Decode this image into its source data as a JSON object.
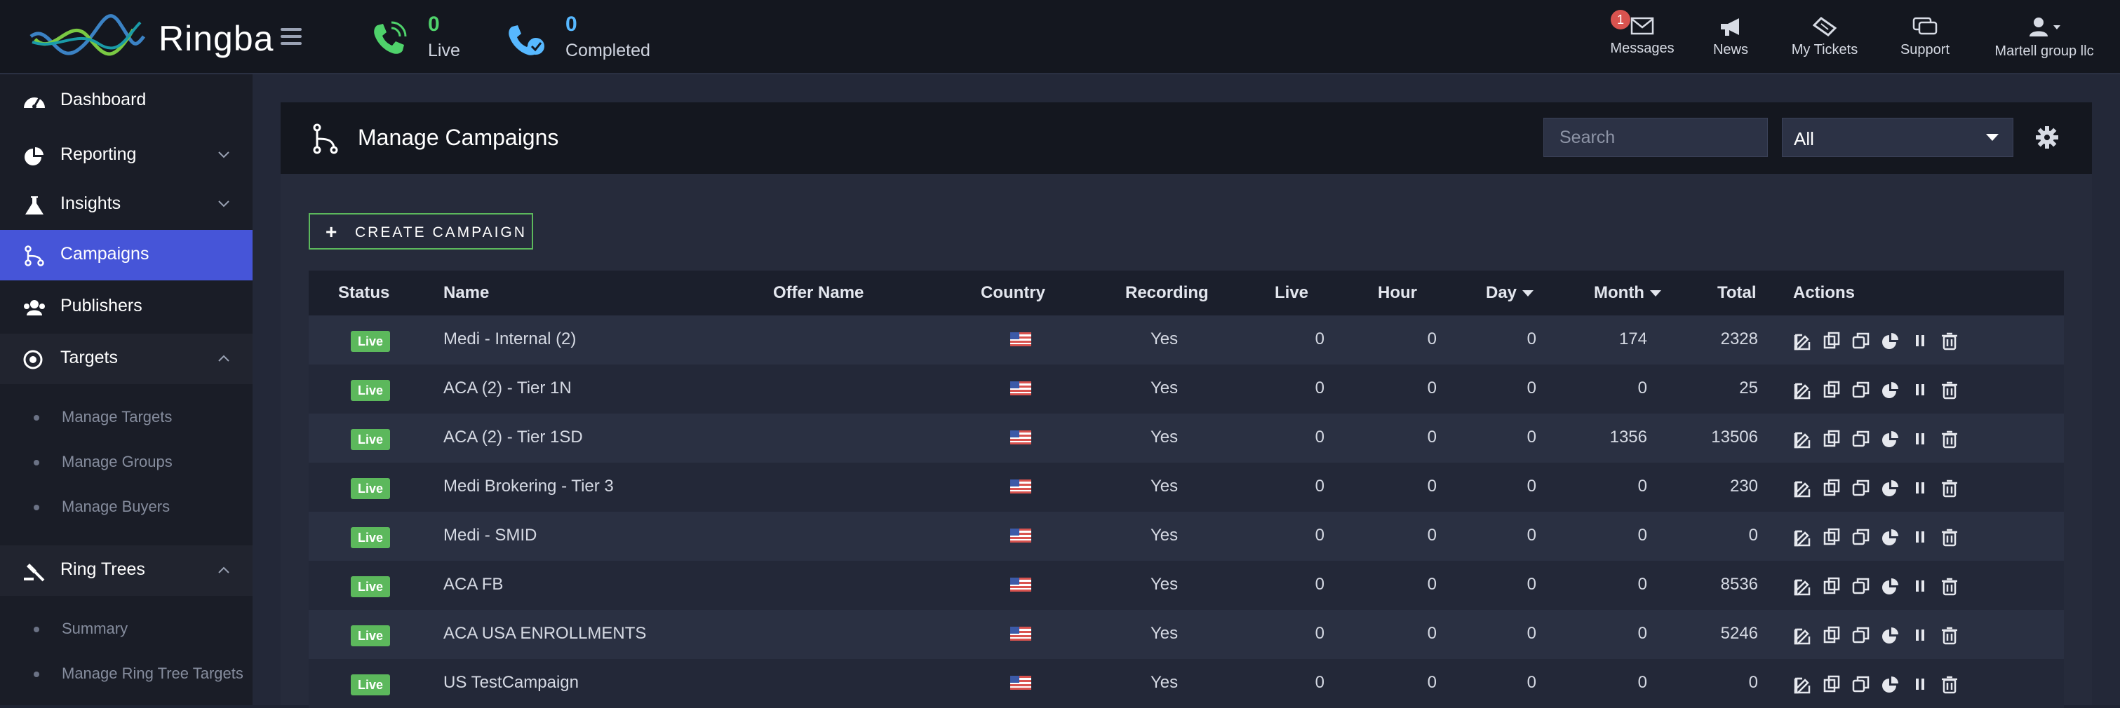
{
  "app": {
    "logo_text": "Ringba",
    "colors": {
      "accent": "#4655d8",
      "live_green": "#5cb85c",
      "live_count": "#4fd26b",
      "completed_count": "#57b8ff"
    }
  },
  "topbar": {
    "live": {
      "count": "0",
      "label": "Live",
      "icon": "phone-live-icon"
    },
    "completed": {
      "count": "0",
      "label": "Completed",
      "icon": "phone-check-icon"
    },
    "nav": [
      {
        "label": "Messages",
        "icon": "envelope-icon",
        "badge": "1"
      },
      {
        "label": "News",
        "icon": "megaphone-icon"
      },
      {
        "label": "My Tickets",
        "icon": "ticket-icon"
      },
      {
        "label": "Support",
        "icon": "chat-icon"
      },
      {
        "label": "Martell group llc",
        "icon": "user-icon"
      }
    ]
  },
  "sidebar": {
    "items": [
      {
        "label": "Dashboard",
        "icon": "dashboard-icon"
      },
      {
        "label": "Reporting",
        "icon": "pie-chart-icon"
      },
      {
        "label": "Insights",
        "icon": "flask-icon"
      },
      {
        "label": "Campaigns",
        "icon": "campaign-icon"
      },
      {
        "label": "Publishers",
        "icon": "users-icon"
      },
      {
        "label": "Targets",
        "icon": "target-icon"
      },
      {
        "label": "Ring Trees",
        "icon": "gavel-icon"
      }
    ],
    "targets_sub": [
      "Manage Targets",
      "Manage Groups",
      "Manage Buyers"
    ],
    "ringtrees_sub": [
      "Summary",
      "Manage Ring Tree Targets"
    ]
  },
  "panel": {
    "title": "Manage Campaigns",
    "search_placeholder": "Search",
    "filter_value": "All",
    "create_label": "CREATE CAMPAIGN"
  },
  "table": {
    "headers": [
      "Status",
      "Name",
      "Offer Name",
      "Country",
      "Recording",
      "Live",
      "Hour",
      "Day",
      "Month",
      "Total",
      "Actions"
    ],
    "rows": [
      {
        "status": "Live",
        "name": "Medi - Internal (2)",
        "offer": "",
        "recording": "Yes",
        "live": "0",
        "hour": "0",
        "day": "0",
        "month": "174",
        "total": "2328"
      },
      {
        "status": "Live",
        "name": "ACA (2) - Tier 1N",
        "offer": "",
        "recording": "Yes",
        "live": "0",
        "hour": "0",
        "day": "0",
        "month": "0",
        "total": "25"
      },
      {
        "status": "Live",
        "name": "ACA (2) - Tier 1SD",
        "offer": "",
        "recording": "Yes",
        "live": "0",
        "hour": "0",
        "day": "0",
        "month": "1356",
        "total": "13506"
      },
      {
        "status": "Live",
        "name": "Medi Brokering - Tier 3",
        "offer": "",
        "recording": "Yes",
        "live": "0",
        "hour": "0",
        "day": "0",
        "month": "0",
        "total": "230"
      },
      {
        "status": "Live",
        "name": "Medi - SMID",
        "offer": "",
        "recording": "Yes",
        "live": "0",
        "hour": "0",
        "day": "0",
        "month": "0",
        "total": "0"
      },
      {
        "status": "Live",
        "name": "ACA FB",
        "offer": "",
        "recording": "Yes",
        "live": "0",
        "hour": "0",
        "day": "0",
        "month": "0",
        "total": "8536"
      },
      {
        "status": "Live",
        "name": "ACA USA ENROLLMENTS",
        "offer": "",
        "recording": "Yes",
        "live": "0",
        "hour": "0",
        "day": "0",
        "month": "0",
        "total": "5246"
      },
      {
        "status": "Live",
        "name": "US TestCampaign",
        "offer": "",
        "recording": "Yes",
        "live": "0",
        "hour": "0",
        "day": "0",
        "month": "0",
        "total": "0"
      }
    ],
    "row_actions": [
      "edit-icon",
      "copy-icon",
      "clone-icon",
      "report-icon",
      "pause-icon",
      "delete-icon"
    ]
  }
}
